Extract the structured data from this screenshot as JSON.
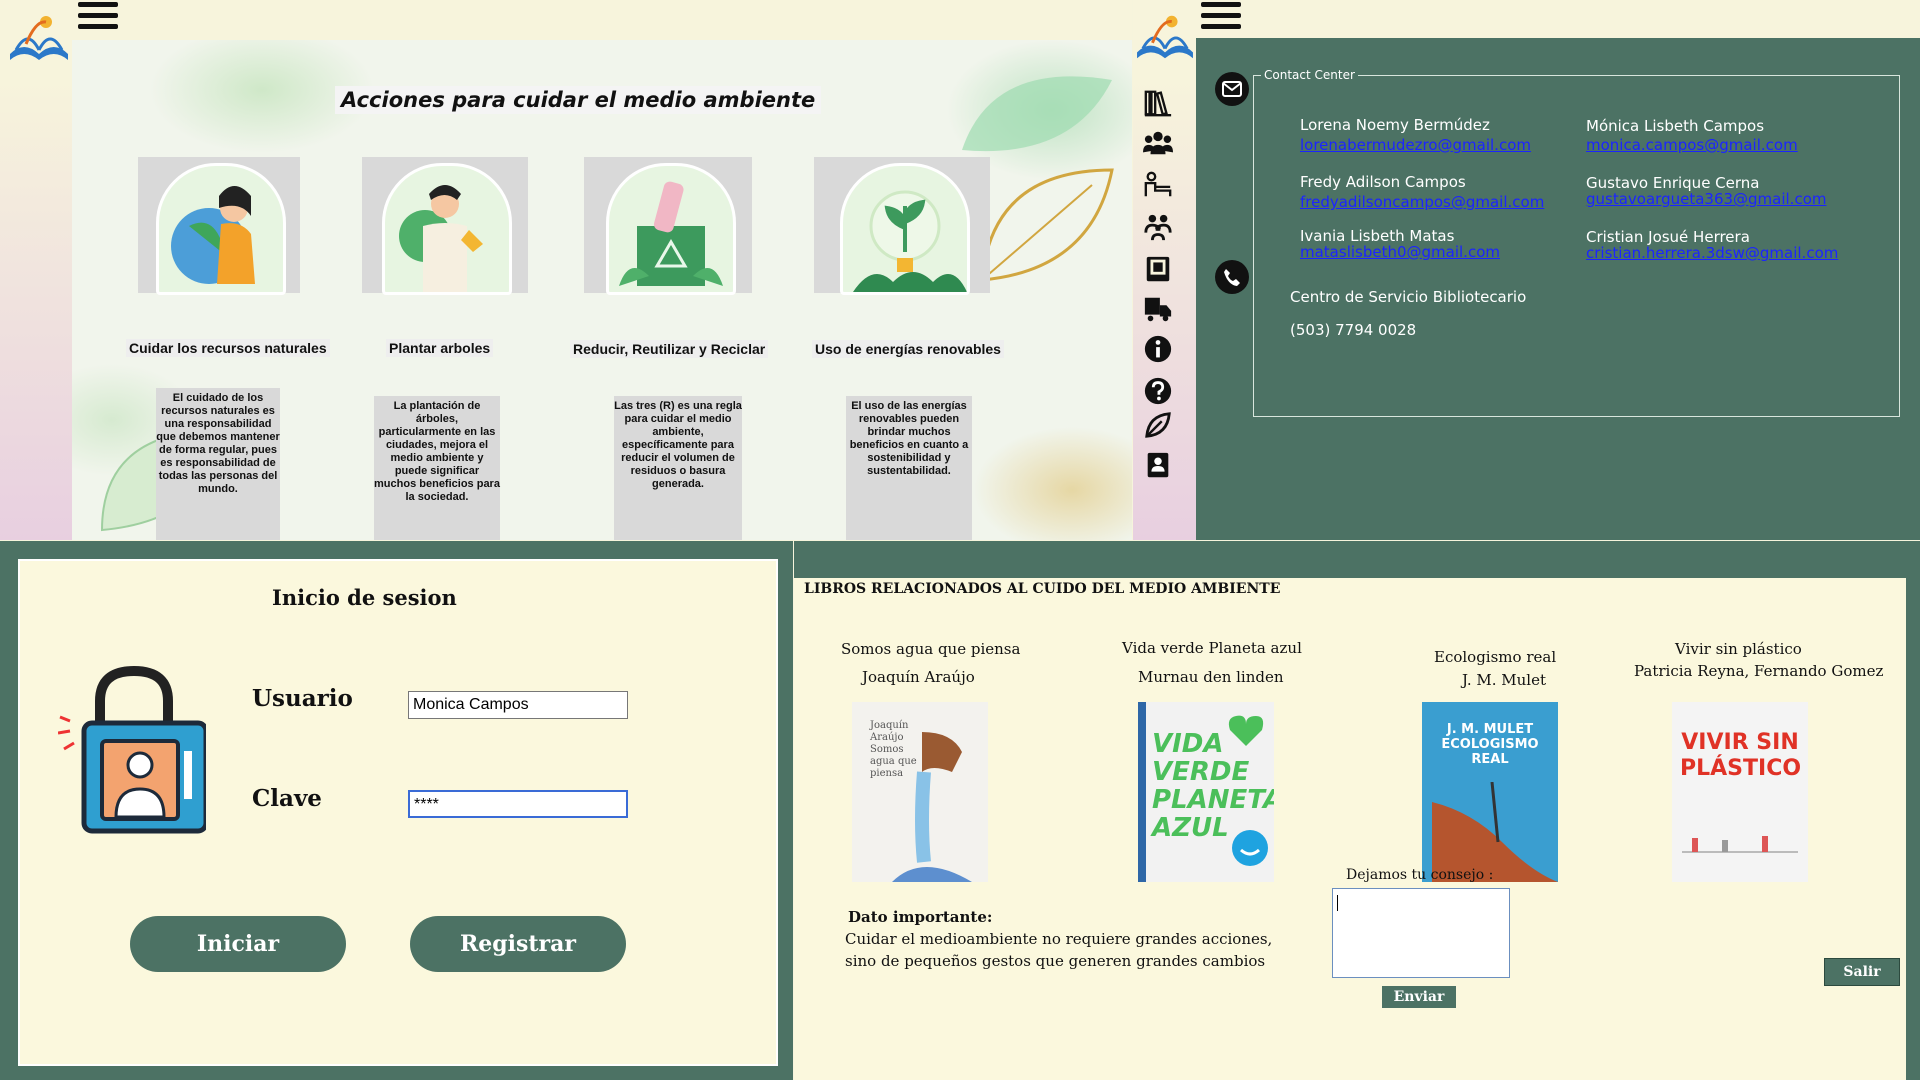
{
  "environment_panel": {
    "title": "Acciones para cuidar el medio ambiente",
    "cards": [
      {
        "label": "Cuidar los recursos naturales",
        "text": "El cuidado de los recursos naturales es una responsabilidad que debemos mantener de forma regular, pues es responsabilidad de todas las personas del mundo."
      },
      {
        "label": "Plantar arboles",
        "text": "La plantación de árboles, particularmente en las ciudades, mejora el medio ambiente y puede significar muchos beneficios para la sociedad."
      },
      {
        "label": "Reducir, Reutilizar y Reciclar",
        "text": "Las tres (R) es una regla para cuidar el medio ambiente, específicamente para reducir el volumen de residuos o basura generada."
      },
      {
        "label": "Uso de energías renovables",
        "text": "El uso de las energías renovables pueden brindar muchos beneficios en cuanto a sostenibilidad y sustentabilidad."
      }
    ]
  },
  "sidebar": {
    "icons": [
      "library-icon",
      "users-group-icon",
      "reading-desk-icon",
      "people-icon",
      "book-icon",
      "delivery-truck-icon",
      "info-icon",
      "help-icon",
      "leaf-icon",
      "contact-book-icon"
    ]
  },
  "contact_panel": {
    "legend": "Contact Center",
    "contacts": [
      {
        "name": "Lorena Noemy Bermúdez",
        "email": "lorenabermudezro@gmail.com"
      },
      {
        "name": "Mónica Lisbeth Campos",
        "email": "monica.campos@gmail.com"
      },
      {
        "name": "Fredy Adilson Campos",
        "email": "fredyadilsoncampos@gmail.com"
      },
      {
        "name": "Gustavo Enrique Cerna",
        "email": "gustavoargueta363@gmail.com"
      },
      {
        "name": "Ivania Lisbeth Matas",
        "email": "mataslisbeth0@gmail.com"
      },
      {
        "name": "Cristian Josué Herrera",
        "email": "cristian.herrera.3dsw@gmail.com"
      }
    ],
    "service_name": "Centro de Servicio Bibliotecario",
    "phone": "(503) 7794 0028"
  },
  "login_panel": {
    "title": "Inicio de sesion",
    "user_label": "Usuario",
    "user_value": "Monica Campos",
    "password_label": "Clave",
    "password_value": "****",
    "login_button": "Iniciar",
    "register_button": "Registrar"
  },
  "books_panel": {
    "heading": "LIBROS RELACIONADOS AL CUIDO DEL MEDIO AMBIENTE",
    "books": [
      {
        "title": "Somos agua que piensa",
        "author": "Joaquín Araújo",
        "cover_text": "Joaquín Araújo\nSomos agua que piensa"
      },
      {
        "title": "Vida verde Planeta azul",
        "author": "Murnau den linden",
        "cover_text": "VIDA VERDE PLANETA AZUL"
      },
      {
        "title": "Ecologismo real",
        "author": "J. M. Mulet",
        "cover_text": "J. M. MULET\nECOLOGISMO REAL"
      },
      {
        "title": "Vivir sin plástico",
        "author": "Patricia Reyna, Fernando Gomez",
        "cover_text": "VIVIR SIN PLÁSTICO"
      }
    ],
    "advice_label": "Dejamos tu consejo :",
    "send_button": "Enviar",
    "exit_button": "Salir",
    "important_title": "Dato importante:",
    "important_text_1": "Cuidar el medioambiente no requiere grandes acciones,",
    "important_text_2": "sino de pequeños gestos que generen grandes cambios"
  }
}
